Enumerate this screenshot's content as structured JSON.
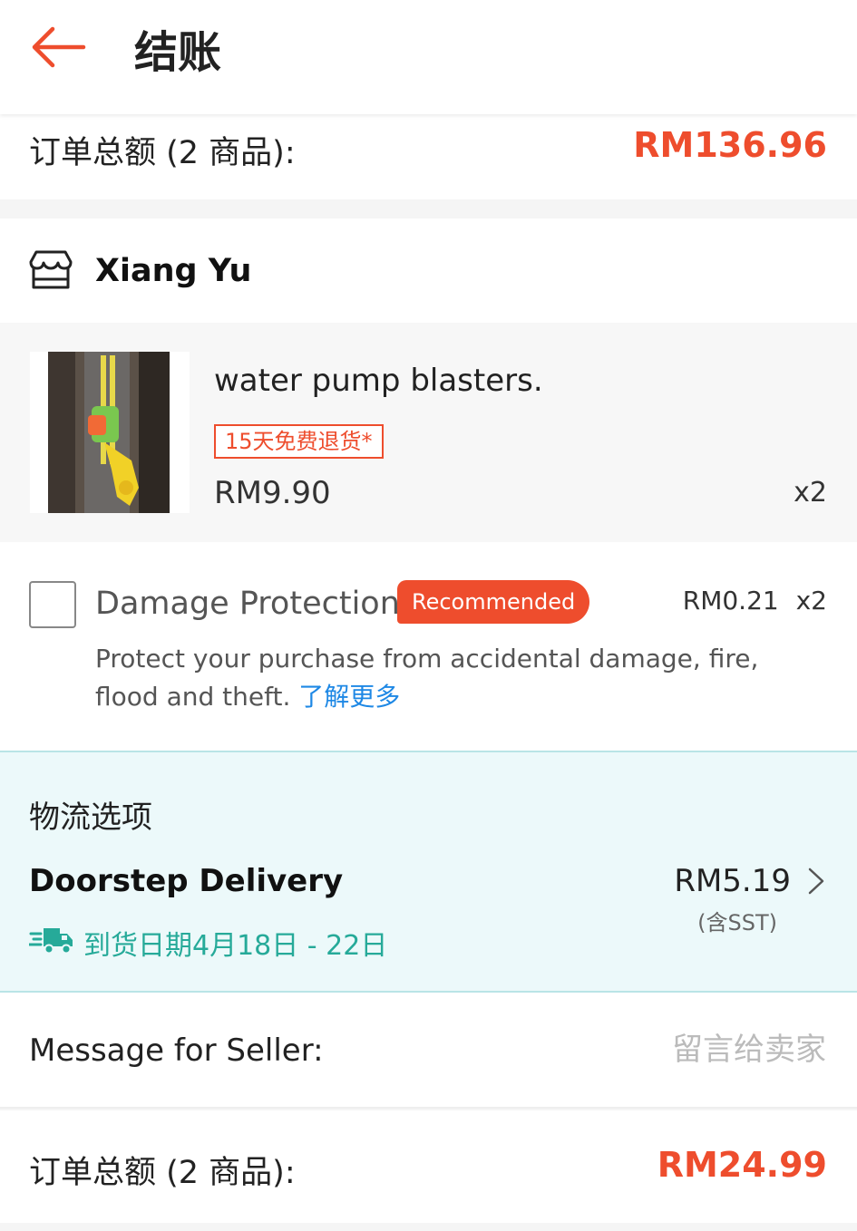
{
  "header": {
    "title": "结账",
    "back_icon": "arrow-left-icon",
    "accent": "#ee4d2d"
  },
  "order_total_top": {
    "label": "订单总额 (2 商品):",
    "amount": "RM136.96"
  },
  "shop": {
    "icon": "store-icon",
    "name": "Xiang Yu"
  },
  "product": {
    "name": "water pump blasters.",
    "return_badge": "15天免费退货*",
    "price": "RM9.90",
    "quantity": "x2"
  },
  "damage_protection": {
    "title": "Damage Protection",
    "badge": "Recommended",
    "price": "RM0.21",
    "quantity": "x2",
    "description": "Protect your purchase from accidental damage, fire, flood and theft.",
    "link": "了解更多",
    "checked": false
  },
  "logistics": {
    "title": "物流选项",
    "option": "Doorstep Delivery",
    "eta": "到货日期4月18日 - 22日",
    "price": "RM5.19",
    "tax_note": "(含SST)",
    "truck_icon": "delivery-truck-icon",
    "accent": "#26aa99"
  },
  "message": {
    "label": "Message for Seller:",
    "placeholder": "留言给卖家",
    "value": ""
  },
  "order_total_bottom": {
    "label": "订单总额 (2 商品):",
    "amount": "RM24.99"
  }
}
